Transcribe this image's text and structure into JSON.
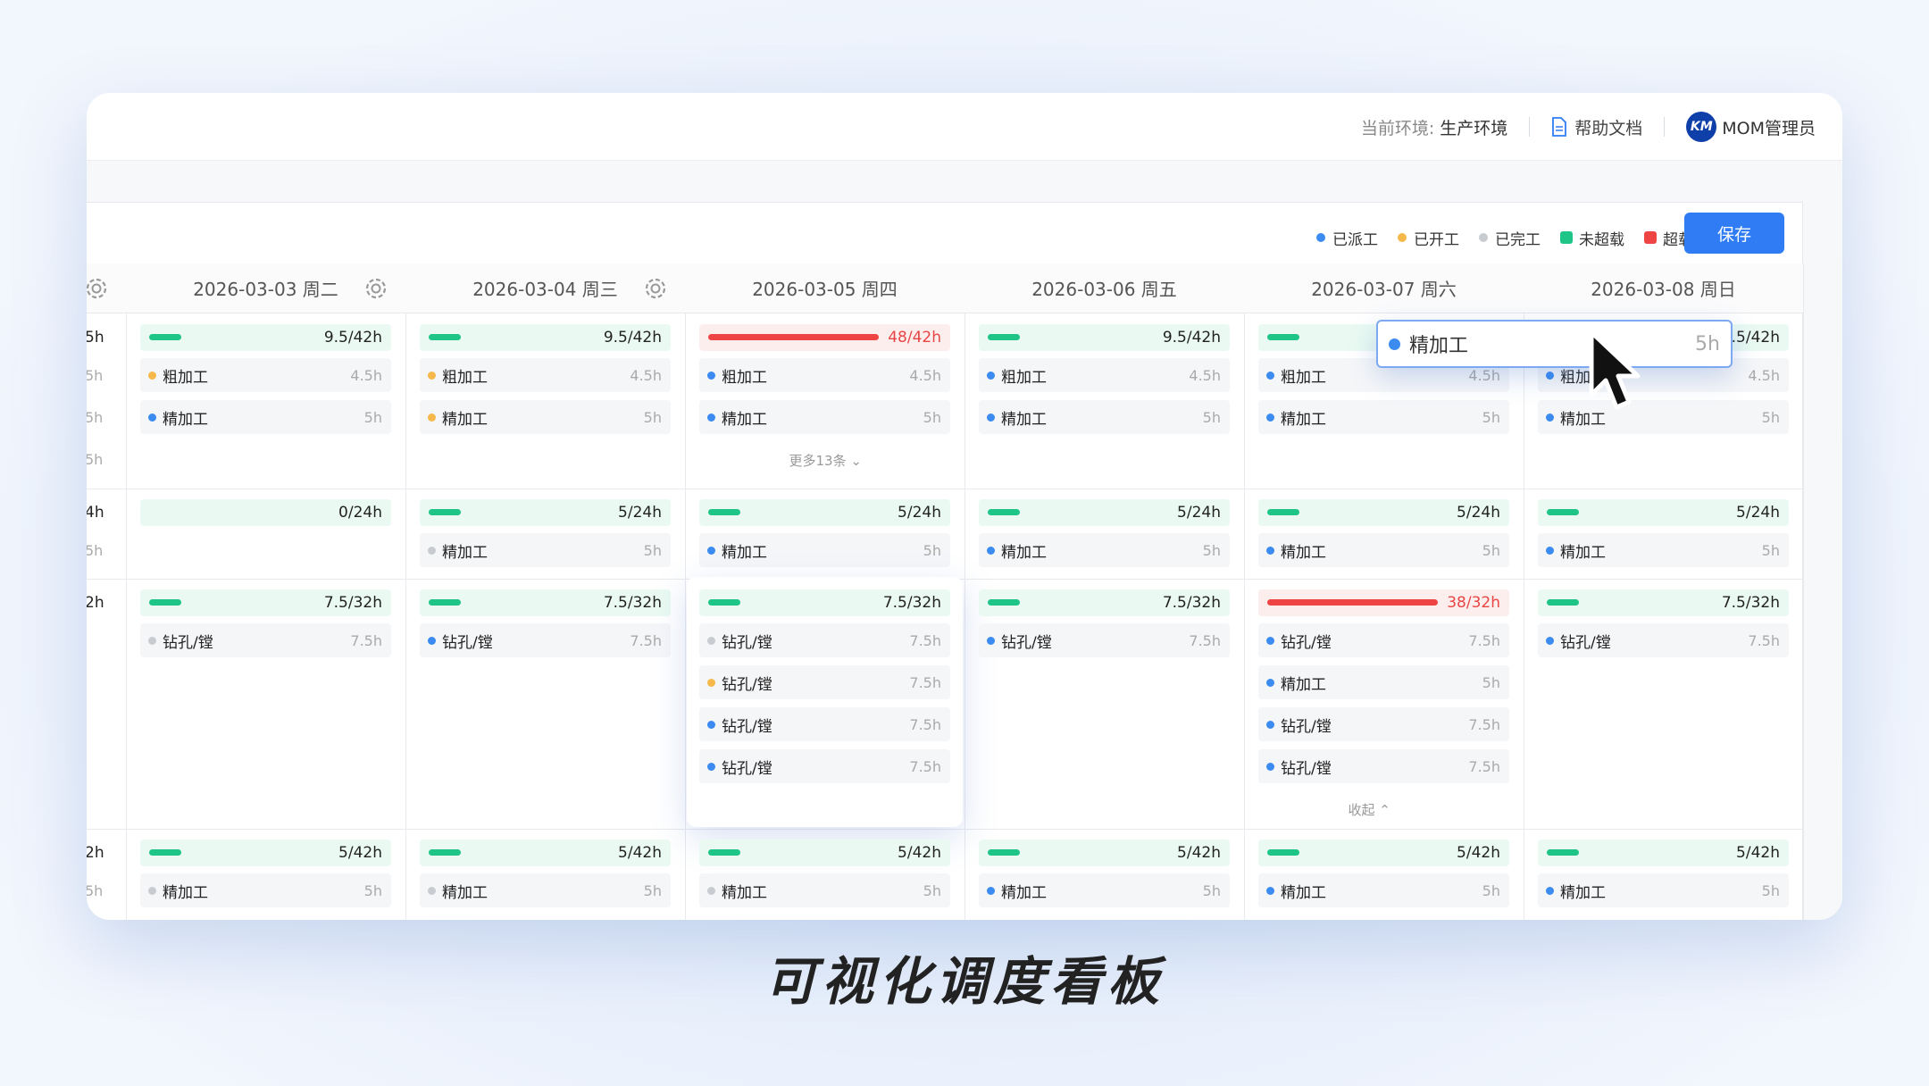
{
  "topbar": {
    "env_label": "当前环境:",
    "env_value": "生产环境",
    "help_label": "帮助文档",
    "user_name": "MOM管理员",
    "avatar_initials": "KM"
  },
  "legend": [
    {
      "label": "已派工",
      "color": "#3b8bf0",
      "shape": "dot"
    },
    {
      "label": "已开工",
      "color": "#f6b84b",
      "shape": "dot"
    },
    {
      "label": "已完工",
      "color": "#c8cbd0",
      "shape": "dot"
    },
    {
      "label": "未超载",
      "color": "#1fc487",
      "shape": "square"
    },
    {
      "label": "超载",
      "color": "#ee4444",
      "shape": "square"
    }
  ],
  "save_label": "保存",
  "days": [
    "2026-03-03 周二",
    "2026-03-04 周三",
    "2026-03-05 周四",
    "2026-03-06 周五",
    "2026-03-07 周六",
    "2026-03-08 周日"
  ],
  "partial_column": {
    "rows": [
      {
        "bar": "5h",
        "tasks": [
          "5h",
          "5h",
          "5h"
        ]
      },
      {
        "bar": "4h",
        "tasks": [
          "5h"
        ]
      },
      {
        "bar": "2h",
        "tasks": []
      },
      {
        "bar": "2h",
        "tasks": [
          "5h"
        ]
      }
    ]
  },
  "rows": [
    {
      "cells": [
        {
          "load": "9.5/42h",
          "fill": 0.3,
          "over": false,
          "tasks": [
            {
              "name": "粗加工",
              "hours": "4.5h",
              "status": "started"
            },
            {
              "name": "精加工",
              "hours": "5h",
              "status": "dispatched"
            }
          ]
        },
        {
          "load": "9.5/42h",
          "fill": 0.3,
          "over": false,
          "tasks": [
            {
              "name": "粗加工",
              "hours": "4.5h",
              "status": "started"
            },
            {
              "name": "精加工",
              "hours": "5h",
              "status": "started"
            }
          ]
        },
        {
          "load": "48/42h",
          "fill": 1.0,
          "over": true,
          "tasks": [
            {
              "name": "粗加工",
              "hours": "4.5h",
              "status": "dispatched"
            },
            {
              "name": "精加工",
              "hours": "5h",
              "status": "dispatched"
            }
          ],
          "more": "更多13条"
        },
        {
          "load": "9.5/42h",
          "fill": 0.3,
          "over": false,
          "tasks": [
            {
              "name": "粗加工",
              "hours": "4.5h",
              "status": "dispatched"
            },
            {
              "name": "精加工",
              "hours": "5h",
              "status": "dispatched"
            }
          ]
        },
        {
          "load": "",
          "fill": 0.3,
          "over": false,
          "tasks": [
            {
              "name": "粗加工",
              "hours": "4.5h",
              "status": "dispatched"
            },
            {
              "name": "精加工",
              "hours": "5h",
              "status": "dispatched"
            }
          ]
        },
        {
          "load": ".5/42h",
          "fill": 0.3,
          "over": false,
          "tasks": [
            {
              "name": "粗加",
              "hours": "4.5h",
              "status": "dispatched"
            },
            {
              "name": "精加工",
              "hours": "5h",
              "status": "dispatched"
            }
          ]
        }
      ]
    },
    {
      "cells": [
        {
          "load": "0/24h",
          "fill": 0,
          "over": false,
          "tasks": []
        },
        {
          "load": "5/24h",
          "fill": 0.3,
          "over": false,
          "tasks": [
            {
              "name": "精加工",
              "hours": "5h",
              "status": "done"
            }
          ]
        },
        {
          "load": "5/24h",
          "fill": 0.3,
          "over": false,
          "tasks": [
            {
              "name": "精加工",
              "hours": "5h",
              "status": "dispatched"
            }
          ]
        },
        {
          "load": "5/24h",
          "fill": 0.3,
          "over": false,
          "tasks": [
            {
              "name": "精加工",
              "hours": "5h",
              "status": "dispatched"
            }
          ]
        },
        {
          "load": "5/24h",
          "fill": 0.3,
          "over": false,
          "tasks": [
            {
              "name": "精加工",
              "hours": "5h",
              "status": "dispatched"
            }
          ]
        },
        {
          "load": "5/24h",
          "fill": 0.3,
          "over": false,
          "tasks": [
            {
              "name": "精加工",
              "hours": "5h",
              "status": "dispatched"
            }
          ]
        }
      ]
    },
    {
      "cells": [
        {
          "load": "7.5/32h",
          "fill": 0.3,
          "over": false,
          "tasks": [
            {
              "name": "钻孔/镗",
              "hours": "7.5h",
              "status": "done"
            }
          ]
        },
        {
          "load": "7.5/32h",
          "fill": 0.3,
          "over": false,
          "tasks": [
            {
              "name": "钻孔/镗",
              "hours": "7.5h",
              "status": "dispatched"
            }
          ]
        },
        {
          "load": "7.5/32h",
          "fill": 0.3,
          "over": false,
          "lifted": true,
          "tasks": [
            {
              "name": "钻孔/镗",
              "hours": "7.5h",
              "status": "done"
            },
            {
              "name": "钻孔/镗",
              "hours": "7.5h",
              "status": "started"
            },
            {
              "name": "钻孔/镗",
              "hours": "7.5h",
              "status": "dispatched"
            },
            {
              "name": "钻孔/镗",
              "hours": "7.5h",
              "status": "dispatched"
            }
          ]
        },
        {
          "load": "7.5/32h",
          "fill": 0.3,
          "over": false,
          "tasks": [
            {
              "name": "钻孔/镗",
              "hours": "7.5h",
              "status": "dispatched"
            }
          ]
        },
        {
          "load": "38/32h",
          "fill": 1.0,
          "over": true,
          "tasks": [
            {
              "name": "钻孔/镗",
              "hours": "7.5h",
              "status": "dispatched"
            },
            {
              "name": "精加工",
              "hours": "5h",
              "status": "dispatched"
            },
            {
              "name": "钻孔/镗",
              "hours": "7.5h",
              "status": "dispatched"
            },
            {
              "name": "钻孔/镗",
              "hours": "7.5h",
              "status": "dispatched"
            }
          ],
          "collapse": "收起"
        },
        {
          "load": "7.5/32h",
          "fill": 0.3,
          "over": false,
          "tasks": [
            {
              "name": "钻孔/镗",
              "hours": "7.5h",
              "status": "dispatched"
            }
          ]
        }
      ]
    },
    {
      "cells": [
        {
          "load": "5/42h",
          "fill": 0.3,
          "over": false,
          "tasks": [
            {
              "name": "精加工",
              "hours": "5h",
              "status": "done"
            }
          ]
        },
        {
          "load": "5/42h",
          "fill": 0.3,
          "over": false,
          "tasks": [
            {
              "name": "精加工",
              "hours": "5h",
              "status": "done"
            }
          ]
        },
        {
          "load": "5/42h",
          "fill": 0.3,
          "over": false,
          "tasks": [
            {
              "name": "精加工",
              "hours": "5h",
              "status": "done"
            }
          ]
        },
        {
          "load": "5/42h",
          "fill": 0.3,
          "over": false,
          "tasks": [
            {
              "name": "精加工",
              "hours": "5h",
              "status": "dispatched"
            }
          ]
        },
        {
          "load": "5/42h",
          "fill": 0.3,
          "over": false,
          "tasks": [
            {
              "name": "精加工",
              "hours": "5h",
              "status": "dispatched"
            }
          ]
        },
        {
          "load": "5/42h",
          "fill": 0.3,
          "over": false,
          "tasks": [
            {
              "name": "精加工",
              "hours": "5h",
              "status": "dispatched"
            }
          ]
        }
      ]
    }
  ],
  "status_colors": {
    "dispatched": "#3b8bf0",
    "started": "#f6b84b",
    "done": "#c8cbd0",
    "ok": "#1fc487",
    "over": "#ee4444"
  },
  "drag_card": {
    "name": "精加工",
    "hours": "5h"
  },
  "caption": "可视化调度看板"
}
